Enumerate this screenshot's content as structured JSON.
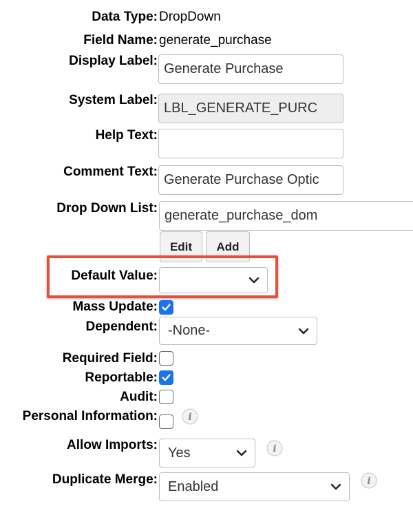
{
  "fields": {
    "data_type": {
      "label": "Data Type:",
      "value": "DropDown"
    },
    "field_name": {
      "label": "Field Name:",
      "value": "generate_purchase"
    },
    "display_label": {
      "label": "Display Label:",
      "value": "Generate Purchase"
    },
    "system_label": {
      "label": "System Label:",
      "value": "LBL_GENERATE_PURC"
    },
    "help_text": {
      "label": "Help Text:",
      "value": ""
    },
    "comment_text": {
      "label": "Comment Text:",
      "value": "Generate Purchase Optic"
    },
    "drop_down_list": {
      "label": "Drop Down List:",
      "value": "generate_purchase_dom",
      "edit_label": "Edit",
      "add_label": "Add"
    },
    "default_value": {
      "label": "Default Value:",
      "value": ""
    },
    "mass_update": {
      "label": "Mass Update:",
      "checked": true
    },
    "dependent": {
      "label": "Dependent:",
      "value": "-None-"
    },
    "required_field": {
      "label": "Required Field:",
      "checked": false
    },
    "reportable": {
      "label": "Reportable:",
      "checked": true
    },
    "audit": {
      "label": "Audit:",
      "checked": false
    },
    "personal_information": {
      "label": "Personal Information:",
      "checked": false
    },
    "allow_imports": {
      "label": "Allow Imports:",
      "value": "Yes"
    },
    "duplicate_merge": {
      "label": "Duplicate Merge:",
      "value": "Enabled"
    }
  },
  "icons": {
    "dropdown": "chevron-down-icon",
    "checkmark": "checkmark-icon",
    "info": "info-icon"
  },
  "colors": {
    "checkbox_checked": "#1a73e8",
    "highlight_border": "#e4513a",
    "disabled_field": "#eeeeee"
  }
}
